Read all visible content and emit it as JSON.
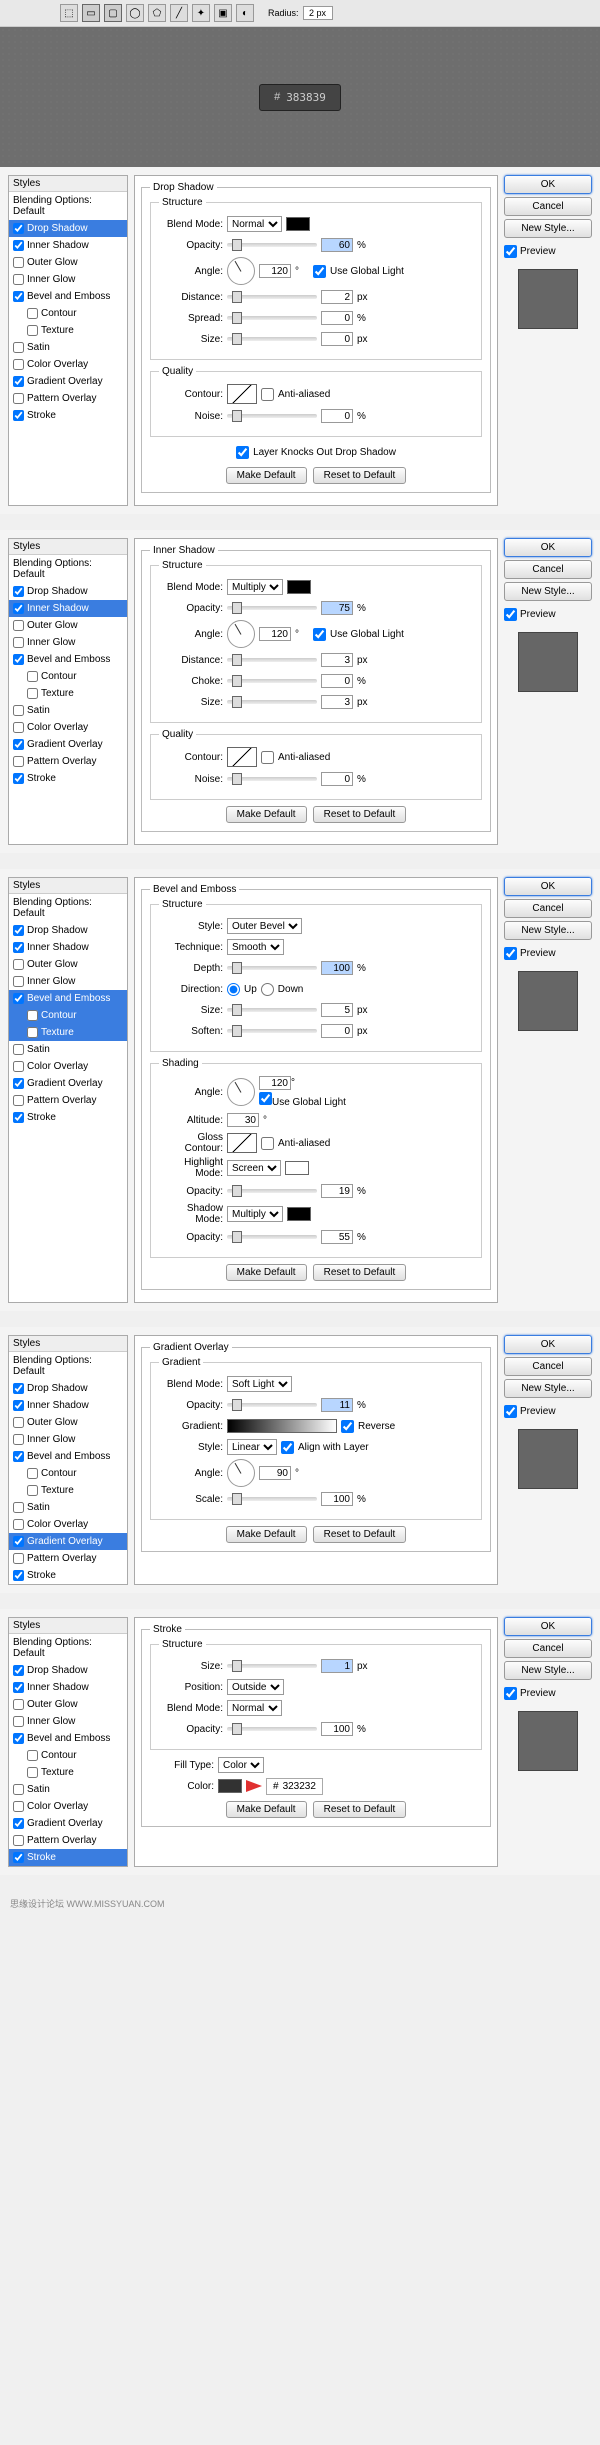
{
  "toolbar": {
    "radius_label": "Radius:",
    "radius_value": "2 px"
  },
  "preview": {
    "hash": "#",
    "hex": "383839"
  },
  "common": {
    "ok": "OK",
    "cancel": "Cancel",
    "new_style": "New Style...",
    "preview": "Preview",
    "make_default": "Make Default",
    "reset_default": "Reset to Default",
    "styles_header": "Styles",
    "blending_options": "Blending Options: Default",
    "use_global_light": "Use Global Light",
    "anti_aliased": "Anti-aliased",
    "layer_knocks": "Layer Knocks Out Drop Shadow"
  },
  "styles_list": [
    {
      "label": "Drop Shadow",
      "checked": true
    },
    {
      "label": "Inner Shadow",
      "checked": true
    },
    {
      "label": "Outer Glow",
      "checked": false
    },
    {
      "label": "Inner Glow",
      "checked": false
    },
    {
      "label": "Bevel and Emboss",
      "checked": true
    },
    {
      "label": "Contour",
      "checked": false,
      "indent": true
    },
    {
      "label": "Texture",
      "checked": false,
      "indent": true
    },
    {
      "label": "Satin",
      "checked": false
    },
    {
      "label": "Color Overlay",
      "checked": false
    },
    {
      "label": "Gradient Overlay",
      "checked": true
    },
    {
      "label": "Pattern Overlay",
      "checked": false
    },
    {
      "label": "Stroke",
      "checked": true
    }
  ],
  "panels": {
    "drop_shadow": {
      "title": "Drop Shadow",
      "structure": "Structure",
      "quality": "Quality",
      "blend_mode_lbl": "Blend Mode:",
      "blend_mode": "Normal",
      "swatch": "#000000",
      "opacity_lbl": "Opacity:",
      "opacity": "60",
      "angle_lbl": "Angle:",
      "angle": "120",
      "distance_lbl": "Distance:",
      "distance": "2",
      "spread_lbl": "Spread:",
      "spread": "0",
      "size_lbl": "Size:",
      "size": "0",
      "contour_lbl": "Contour:",
      "noise_lbl": "Noise:",
      "noise": "0",
      "pct": "%",
      "px": "px",
      "deg": "°"
    },
    "inner_shadow": {
      "title": "Inner Shadow",
      "structure": "Structure",
      "quality": "Quality",
      "blend_mode_lbl": "Blend Mode:",
      "blend_mode": "Multiply",
      "swatch": "#000000",
      "opacity_lbl": "Opacity:",
      "opacity": "75",
      "angle_lbl": "Angle:",
      "angle": "120",
      "distance_lbl": "Distance:",
      "distance": "3",
      "choke_lbl": "Choke:",
      "choke": "0",
      "size_lbl": "Size:",
      "size": "3",
      "contour_lbl": "Contour:",
      "noise_lbl": "Noise:",
      "noise": "0",
      "pct": "%",
      "px": "px",
      "deg": "°"
    },
    "bevel": {
      "title": "Bevel and Emboss",
      "structure": "Structure",
      "shading": "Shading",
      "style_lbl": "Style:",
      "style": "Outer Bevel",
      "technique_lbl": "Technique:",
      "technique": "Smooth",
      "depth_lbl": "Depth:",
      "depth": "100",
      "direction_lbl": "Direction:",
      "up": "Up",
      "down": "Down",
      "size_lbl": "Size:",
      "size": "5",
      "soften_lbl": "Soften:",
      "soften": "0",
      "angle_lbl": "Angle:",
      "angle": "120",
      "altitude_lbl": "Altitude:",
      "altitude": "30",
      "gloss_lbl": "Gloss Contour:",
      "highlight_lbl": "Highlight Mode:",
      "highlight": "Screen",
      "highlight_swatch": "#ffffff",
      "hi_opacity_lbl": "Opacity:",
      "hi_opacity": "19",
      "shadow_lbl": "Shadow Mode:",
      "shadow": "Multiply",
      "shadow_swatch": "#000000",
      "sh_opacity_lbl": "Opacity:",
      "sh_opacity": "55",
      "pct": "%",
      "px": "px",
      "deg": "°"
    },
    "gradient": {
      "title": "Gradient Overlay",
      "section": "Gradient",
      "blend_mode_lbl": "Blend Mode:",
      "blend_mode": "Soft Light",
      "opacity_lbl": "Opacity:",
      "opacity": "11",
      "gradient_lbl": "Gradient:",
      "reverse": "Reverse",
      "style_lbl": "Style:",
      "style": "Linear",
      "align": "Align with Layer",
      "angle_lbl": "Angle:",
      "angle": "90",
      "scale_lbl": "Scale:",
      "scale": "100",
      "pct": "%",
      "deg": "°"
    },
    "stroke": {
      "title": "Stroke",
      "structure": "Structure",
      "size_lbl": "Size:",
      "size": "1",
      "position_lbl": "Position:",
      "position": "Outside",
      "blend_mode_lbl": "Blend Mode:",
      "blend_mode": "Normal",
      "opacity_lbl": "Opacity:",
      "opacity": "100",
      "fill_type_lbl": "Fill Type:",
      "fill_type": "Color",
      "color_lbl": "Color:",
      "color_hex": "323232",
      "hash": "#",
      "pct": "%",
      "px": "px"
    }
  },
  "footer": "思缘设计论坛   WWW.MISSYUAN.COM"
}
